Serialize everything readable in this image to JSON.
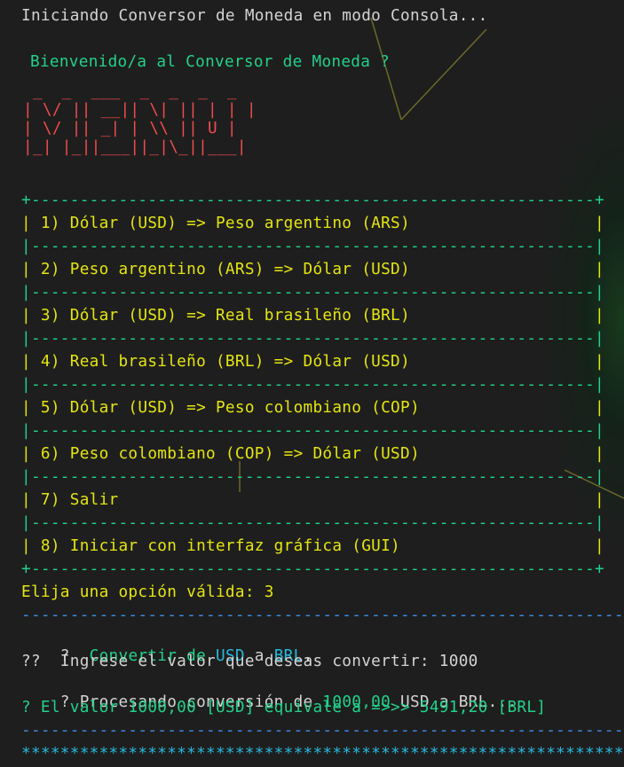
{
  "colors": {
    "background": "#1e1e1e",
    "text": "#d4d4d4",
    "green": "#23d18b",
    "yellow": "#e5e510",
    "red": "#f14c4c",
    "blue": "#3b8eea",
    "cyan": "#29b8db"
  },
  "console": {
    "starting": "Iniciando Conversor de Moneda en modo Consola...",
    "welcome": "Bienvenido/a al Conversor de Moneda ?",
    "banner_art": " _  _  ___  _  _  _  _ \n| \\/ || __|| \\| || | | |\n| \\/ || _| | \\\\ || U |\n|_| |_||___||_|\\_||___|",
    "menu": {
      "border_top": "+----------------------------------------------------------+",
      "separator": "|----------------------------------------------------------|",
      "border_bottom": "+----------------------------------------------------------+",
      "items": [
        "| 1) Dólar (USD) => Peso argentino (ARS)                   |",
        "| 2) Peso argentino (ARS) => Dólar (USD)                   |",
        "| 3) Dólar (USD) => Real brasileño (BRL)                   |",
        "| 4) Real brasileño (BRL) => Dólar (USD)                   |",
        "| 5) Dólar (USD) => Peso colombiano (COP)                  |",
        "| 6) Peso colombiano (COP) => Dólar (USD)                  |",
        "| 7) Salir                                                 |",
        "| 8) Iniciar con interfaz gráfica (GUI)                    |"
      ]
    },
    "prompt": "Elija una opción válida: 3",
    "dash_line": "------------------------------------------------------------------",
    "convert": {
      "prefix": "?  ",
      "word": "Convertir de ",
      "from": "USD",
      "a": " a ",
      "to": "BRL",
      "dot": "."
    },
    "enter_value": "??  Ingrese el valor que deseas convertir: 1000",
    "processing": {
      "prefix": "? Procesando conversión de ",
      "amount": "1000,00",
      "suffix": " USD a BRL..."
    },
    "result": "? El valor 1000,00 [USD] equivale a =>>> 5491,20 [BRL]",
    "star_line": "**************************************************************************"
  }
}
